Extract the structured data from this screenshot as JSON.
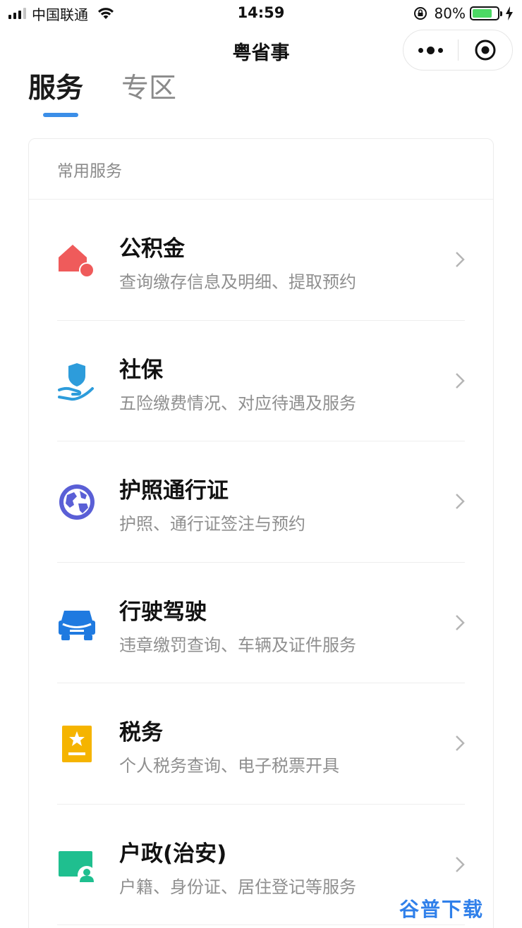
{
  "status_bar": {
    "carrier": "中国联通",
    "time": "14:59",
    "battery": "80%",
    "battery_level": 0.8
  },
  "nav": {
    "title": "粤省事"
  },
  "tabs": [
    {
      "label": "服务",
      "active": true
    },
    {
      "label": "专区",
      "active": false
    }
  ],
  "card": {
    "header": "常用服务",
    "items": [
      {
        "title": "公积金",
        "subtitle": "查询缴存信息及明细、提取预约",
        "icon": "house-fund-icon",
        "color": "#ef5b5b"
      },
      {
        "title": "社保",
        "subtitle": "五险缴费情况、对应待遇及服务",
        "icon": "social-insurance-icon",
        "color": "#2d9cdb"
      },
      {
        "title": "护照通行证",
        "subtitle": "护照、通行证签注与预约",
        "icon": "globe-icon",
        "color": "#5a5fd6"
      },
      {
        "title": "行驶驾驶",
        "subtitle": "违章缴罚查询、车辆及证件服务",
        "icon": "car-icon",
        "color": "#1f7ae0"
      },
      {
        "title": "税务",
        "subtitle": "个人税务查询、电子税票开具",
        "icon": "tax-star-icon",
        "color": "#f5b400"
      },
      {
        "title": "户政(治安)",
        "subtitle": "户籍、身份证、居住登记等服务",
        "icon": "id-card-icon",
        "color": "#1fbf8f"
      }
    ]
  },
  "watermark": "谷普下载",
  "colors": {
    "tab_indicator": "#3b8ee8",
    "battery": "#4cd964"
  }
}
